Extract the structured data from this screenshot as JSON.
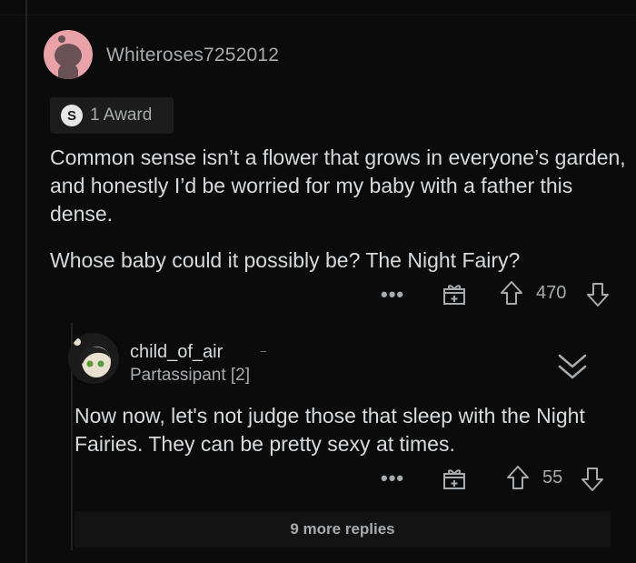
{
  "comment": {
    "username": "Whiteroses7252012",
    "award_label": "1 Award",
    "award_icon": "silver-award-icon",
    "paragraphs": [
      "Common sense isn’t a flower that grows in everyone’s garden, and honestly I’d be worried for my baby with a father this dense.",
      "Whose baby could it possibly be? The Night Fairy?"
    ],
    "more_label": "•••",
    "votes": "470"
  },
  "reply": {
    "username": "child_of_air",
    "flair": "Partassipant [2]",
    "text": "Now now, let's not judge those that sleep with the Night Fairies. They can be pretty sexy at times.",
    "more_label": "•••",
    "votes": "55",
    "more_replies_label": "9 more replies"
  },
  "colors": {
    "background": "#0b0b0b",
    "text": "#d7dadc",
    "muted": "#a8abad",
    "avatar1_bg": "#e9a3a8"
  }
}
